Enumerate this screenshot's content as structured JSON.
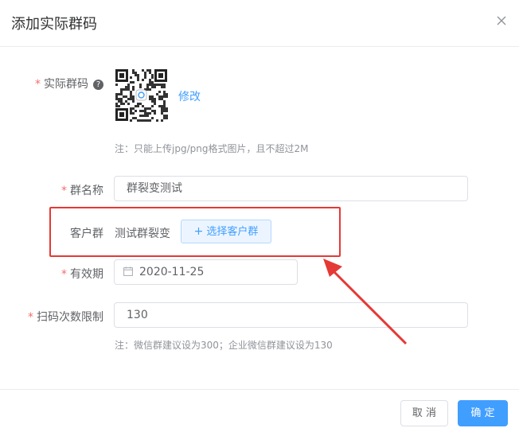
{
  "dialog": {
    "title": "添加实际群码",
    "close_icon": "close-icon"
  },
  "form": {
    "qr": {
      "label": "实际群码",
      "required_mark": "*",
      "help_glyph": "?",
      "edit_label": "修改",
      "tip": "注：只能上传jpg/png格式图片，且不超过2M"
    },
    "group_name": {
      "label": "群名称",
      "required_mark": "*",
      "value": "群裂变测试"
    },
    "customer_group": {
      "label": "客户群",
      "value": "测试群裂变",
      "button_icon": "+",
      "button_label": "选择客户群"
    },
    "validity": {
      "label": "有效期",
      "required_mark": "*",
      "value": "2020-11-25"
    },
    "scan_limit": {
      "label": "扫码次数限制",
      "required_mark": "*",
      "value": "130",
      "tip": "注：微信群建议设为300；企业微信群建议设为130"
    }
  },
  "footer": {
    "cancel_label": "取 消",
    "ok_label": "确 定"
  },
  "colors": {
    "primary": "#409eff",
    "required": "#f56c6c",
    "annotation": "#e53935"
  }
}
